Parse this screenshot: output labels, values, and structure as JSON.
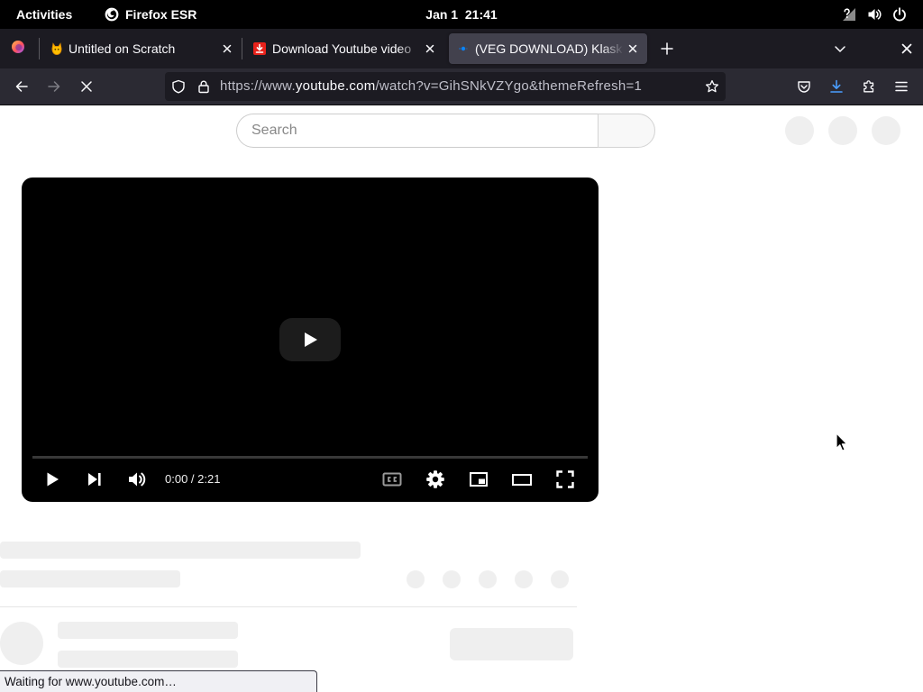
{
  "system_bar": {
    "activities_label": "Activities",
    "app_name": "Firefox ESR",
    "clock": "Jan 1  21:41",
    "status_icons": [
      "network-question-icon",
      "volume-icon",
      "power-icon"
    ]
  },
  "browser": {
    "tabs": [
      {
        "title": "Untitled on Scratch",
        "icon": "scratch-icon",
        "active": false
      },
      {
        "title": "Download Youtube video",
        "icon": "download-site-icon",
        "active": false
      },
      {
        "title": "(VEG DOWNLOAD) Klask",
        "icon": "loading-icon",
        "active": true
      }
    ],
    "url": {
      "prefix": "https://www.",
      "domain": "youtube.com",
      "path": "/watch?v=GihSNkVZYgo&themeRefresh=1"
    },
    "toolbar_icons": [
      "back-arrow-icon",
      "forward-arrow-icon",
      "stop-icon",
      "shield-icon",
      "lock-icon",
      "star-icon",
      "pocket-icon",
      "download-icon",
      "extensions-icon",
      "menu-icon"
    ],
    "status_text": "Waiting for www.youtube.com…"
  },
  "page": {
    "search": {
      "placeholder": "Search"
    },
    "player": {
      "time_display": "0:00 / 2:21",
      "progress": 0,
      "control_icons": [
        "play-icon",
        "next-icon",
        "volume-icon",
        "captions-icon",
        "settings-icon",
        "miniplayer-icon",
        "theater-icon",
        "fullscreen-icon"
      ]
    }
  },
  "colors": {
    "system_bar_bg": "#000000",
    "tab_strip_bg": "#1c1b22",
    "toolbar_bg": "#2b2a33",
    "active_tab_bg": "#42414d",
    "urlbar_bg": "#1c1b22",
    "download_accent": "#4a9eff",
    "page_bg": "#ffffff",
    "player_bg": "#000000",
    "skeleton": "#efefef"
  }
}
